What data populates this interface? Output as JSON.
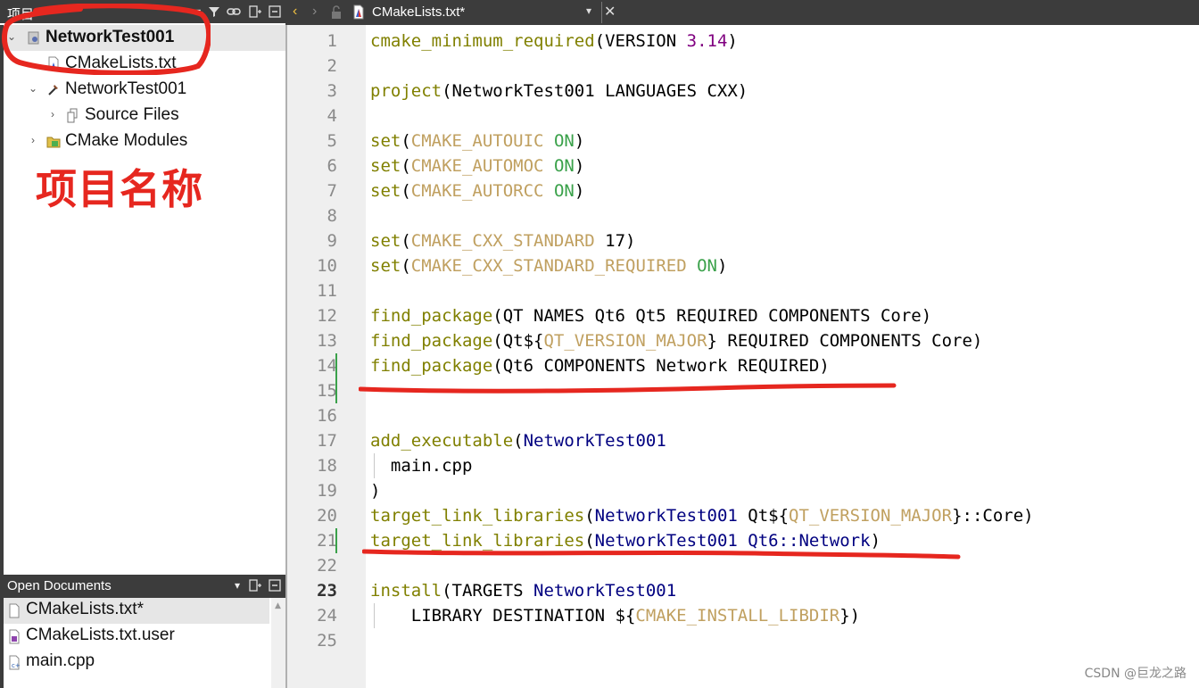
{
  "project_pane": {
    "header_title": "项目",
    "tree": [
      {
        "label": "NetworkTest001",
        "bold": true,
        "icon": "cmake-project-icon",
        "expanded": true,
        "selected": true
      },
      {
        "label": "CMakeLists.txt",
        "icon": "cmake-file-icon"
      },
      {
        "label": "NetworkTest001",
        "icon": "build-target-icon",
        "expanded": true
      },
      {
        "label": "Source Files",
        "icon": "source-files-icon",
        "expanded": false
      },
      {
        "label": "CMake Modules",
        "icon": "cmake-modules-folder-icon",
        "expanded": false
      }
    ],
    "annotation": "项目名称"
  },
  "open_documents": {
    "header_title": "Open Documents",
    "items": [
      {
        "label": "CMakeLists.txt*",
        "selected": true,
        "icon": "text-file-icon"
      },
      {
        "label": "CMakeLists.txt.user",
        "icon": "user-file-icon"
      },
      {
        "label": "main.cpp",
        "icon": "cpp-file-icon"
      }
    ]
  },
  "editor": {
    "tab_title": "CMakeLists.txt*",
    "current_line": 23,
    "lines": [
      {
        "n": "1",
        "t": "cmake_minimum_required(VERSION 3.14)"
      },
      {
        "n": "2",
        "t": ""
      },
      {
        "n": "3",
        "t": "project(NetworkTest001 LANGUAGES CXX)"
      },
      {
        "n": "4",
        "t": ""
      },
      {
        "n": "5",
        "t": "set(CMAKE_AUTOUIC ON)"
      },
      {
        "n": "6",
        "t": "set(CMAKE_AUTOMOC ON)"
      },
      {
        "n": "7",
        "t": "set(CMAKE_AUTORCC ON)"
      },
      {
        "n": "8",
        "t": ""
      },
      {
        "n": "9",
        "t": "set(CMAKE_CXX_STANDARD 17)"
      },
      {
        "n": "10",
        "t": "set(CMAKE_CXX_STANDARD_REQUIRED ON)"
      },
      {
        "n": "11",
        "t": ""
      },
      {
        "n": "12",
        "t": "find_package(QT NAMES Qt6 Qt5 REQUIRED COMPONENTS Core)"
      },
      {
        "n": "13",
        "t": "find_package(Qt${QT_VERSION_MAJOR} REQUIRED COMPONENTS Core)"
      },
      {
        "n": "14",
        "t": "find_package(Qt6 COMPONENTS Network REQUIRED)"
      },
      {
        "n": "15",
        "t": ""
      },
      {
        "n": "16",
        "t": ""
      },
      {
        "n": "17",
        "t": "add_executable(NetworkTest001"
      },
      {
        "n": "18",
        "t": "  main.cpp"
      },
      {
        "n": "19",
        "t": ")"
      },
      {
        "n": "20",
        "t": "target_link_libraries(NetworkTest001 Qt${QT_VERSION_MAJOR}::Core)"
      },
      {
        "n": "21",
        "t": "target_link_libraries(NetworkTest001 Qt6::Network)"
      },
      {
        "n": "22",
        "t": ""
      },
      {
        "n": "23",
        "t": "install(TARGETS NetworkTest001"
      },
      {
        "n": "24",
        "t": "    LIBRARY DESTINATION ${CMAKE_INSTALL_LIBDIR})"
      },
      {
        "n": "25",
        "t": ""
      }
    ]
  },
  "watermark": "CSDN @巨龙之路",
  "colors": {
    "annotation_red": "#e6271f",
    "keyword": "#808000",
    "variable": "#c0a060",
    "on_value": "#3aa14a",
    "number": "#800080",
    "target": "#000080",
    "panel_header": "#3c3c3c"
  }
}
